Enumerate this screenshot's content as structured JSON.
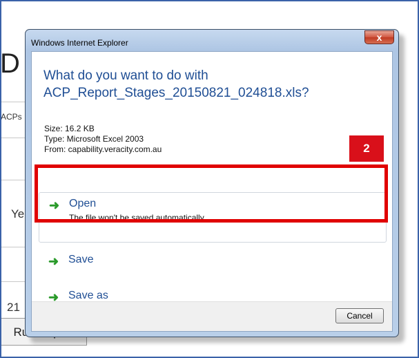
{
  "background": {
    "heading_fragment": "D",
    "tab_fragment": "ACPs",
    "row_text_1": "Ye",
    "row_text_2": "21",
    "run_report_label": "Run Report"
  },
  "dialog": {
    "title": "Windows Internet Explorer",
    "close_label": "x",
    "question_line1": "What do you want to do with",
    "question_line2": "ACP_Report_Stages_20150821_024818.xls?",
    "size": "Size: 16.2 KB",
    "type": "Type: Microsoft Excel 2003",
    "from": "From: capability.veracity.com.au",
    "options": {
      "open_label": "Open",
      "open_sub": "The file won't be saved automatically.",
      "save_label": "Save",
      "saveas_label": "Save as"
    },
    "cancel_label": "Cancel"
  },
  "annotation": {
    "step_number": "2",
    "color": "#d9101a"
  },
  "icons": {
    "option_arrow": "green-right-arrow-icon"
  }
}
